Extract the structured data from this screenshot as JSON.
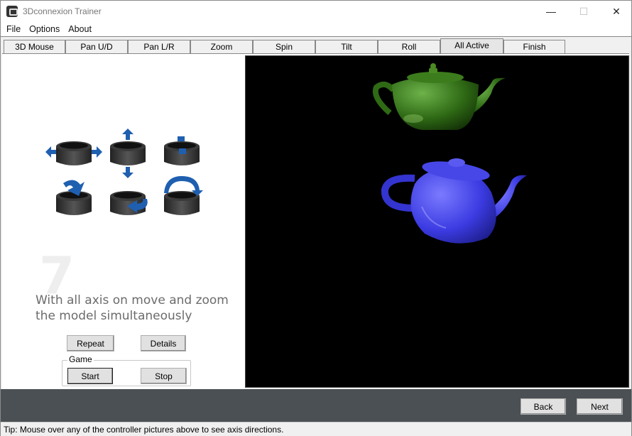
{
  "window": {
    "title": "3Dconnexion Trainer",
    "controls": {
      "minimize": "—",
      "maximize": "☐",
      "close": "✕"
    }
  },
  "menu": [
    "File",
    "Options",
    "About"
  ],
  "tabs": [
    "3D Mouse",
    "Pan U/D",
    "Pan L/R",
    "Zoom",
    "Spin",
    "Tilt",
    "Roll",
    "All Active",
    "Finish"
  ],
  "active_tab": "All Active",
  "lesson": {
    "step_number": "7",
    "instruction": "With all axis on move and zoom the model simultaneously",
    "repeat_label": "Repeat",
    "details_label": "Details"
  },
  "game": {
    "label": "Game",
    "start_label": "Start",
    "stop_label": "Stop"
  },
  "nav": {
    "back_label": "Back",
    "next_label": "Next"
  },
  "status": "Tip: Mouse over any of the controller pictures above to see axis directions.",
  "colors": {
    "target_teapot": "#3f7a1e",
    "user_teapot": "#3a3adf",
    "arrow": "#1f5fb0",
    "bottom_bar": "#4b5054"
  },
  "controller_icons": [
    "pan-left-right-icon",
    "pan-up-down-icon",
    "zoom-icon",
    "tilt-icon",
    "spin-icon",
    "roll-icon"
  ]
}
